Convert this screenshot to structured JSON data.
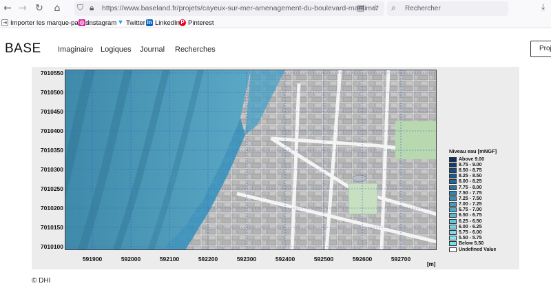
{
  "browser": {
    "url": "https://www.baseland.fr/projets/cayeux-sur-mer-amenagement-du-boulevard-maritime/",
    "search_placeholder": "Rechercher",
    "bookmarks": [
      {
        "label": "Importer les marque-pages…",
        "icon": "import-icon"
      },
      {
        "label": "Instagram",
        "icon": "instagram-icon"
      },
      {
        "label": "Twitter",
        "icon": "twitter-icon"
      },
      {
        "label": "LinkedIn",
        "icon": "linkedin-icon"
      },
      {
        "label": "Pinterest",
        "icon": "pinterest-icon"
      }
    ]
  },
  "site": {
    "logo": "BASE",
    "nav": [
      "Imaginaire",
      "Logiques",
      "Journal",
      "Recherches"
    ],
    "project_button": "Proj"
  },
  "map": {
    "y_ticks": [
      "7010550",
      "7010500",
      "7010450",
      "7010400",
      "7010350",
      "7010300",
      "7010250",
      "7010200",
      "7010150",
      "7010100"
    ],
    "x_ticks": [
      "591900",
      "592000",
      "592100",
      "592200",
      "592300",
      "592400",
      "592500",
      "592600",
      "592700"
    ],
    "x_unit": "[m]",
    "legend_title": "Niveau eau [mNGF]",
    "legend": [
      {
        "label": "Above 9.00",
        "color": "#0b2f5f"
      },
      {
        "label": "8.75 - 9.00",
        "color": "#113d72"
      },
      {
        "label": "8.50 - 8.75",
        "color": "#174b84"
      },
      {
        "label": "8.25 - 8.50",
        "color": "#1d5990"
      },
      {
        "label": "8.00 - 8.25",
        "color": "#23679a"
      },
      {
        "label": "7.75 - 8.00",
        "color": "#2a74a3"
      },
      {
        "label": "7.50 - 7.75",
        "color": "#3282ad"
      },
      {
        "label": "7.25 - 7.50",
        "color": "#3b8fb7"
      },
      {
        "label": "7.00 - 7.25",
        "color": "#459cc0"
      },
      {
        "label": "6.75 - 7.00",
        "color": "#50a9c9"
      },
      {
        "label": "6.50 - 6.75",
        "color": "#5cb6d2"
      },
      {
        "label": "6.25 - 6.50",
        "color": "#69c3da"
      },
      {
        "label": "6.00 - 6.25",
        "color": "#76cfe2"
      },
      {
        "label": "5.75 - 6.00",
        "color": "#82d9e9"
      },
      {
        "label": "5.50 - 5.75",
        "color": "#8ee2ef"
      },
      {
        "label": "Below 5.50",
        "color": "#6fe3f0"
      },
      {
        "label": "Undefined Value",
        "color": "#ffffff"
      }
    ]
  },
  "copyright": "© DHI"
}
